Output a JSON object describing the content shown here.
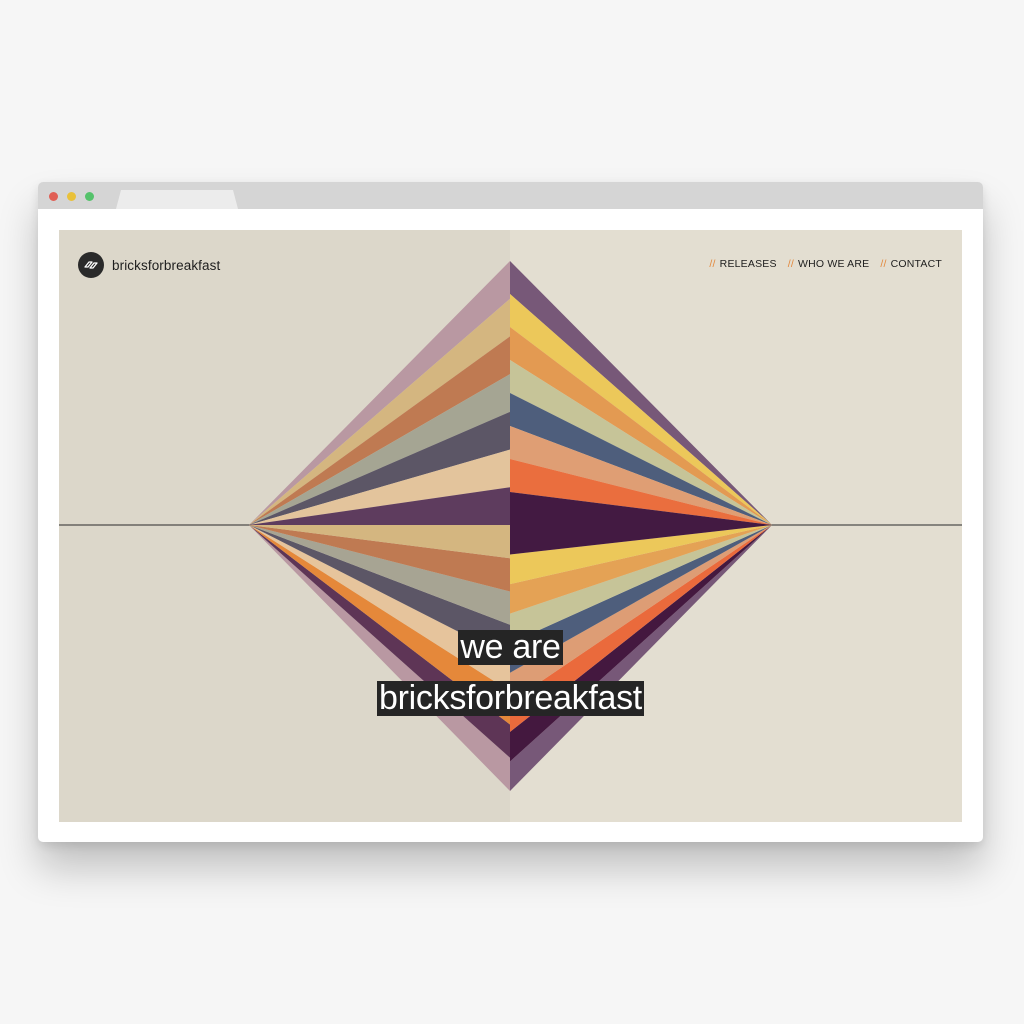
{
  "site": {
    "brand": "bricksforbreakfast",
    "nav": [
      {
        "sep": "//",
        "label": "RELEASES"
      },
      {
        "sep": "//",
        "label": "WHO WE ARE"
      },
      {
        "sep": "//",
        "label": "CONTACT"
      }
    ],
    "hero": {
      "line1": "we are",
      "line2": "bricksforbreakfast"
    }
  },
  "colors": {
    "chrome": "#d5d5d5",
    "dot_red": "#e05f55",
    "dot_yellow": "#e9c13a",
    "dot_green": "#55c26b",
    "bg_left": "#dcd7ca",
    "bg_right": "#e3ded1",
    "accent": "#e3873a",
    "ink": "#252525"
  },
  "icons": {
    "logo": "bricks-logo-icon"
  }
}
